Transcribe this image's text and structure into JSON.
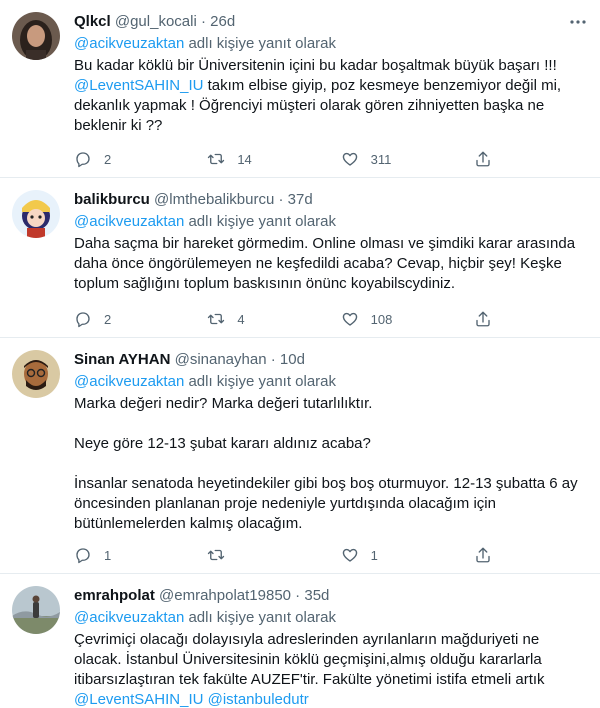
{
  "tweets": [
    {
      "name": "Qlkcl",
      "handle": "@gul_kocali",
      "time": "26d",
      "reply_prefix": "@acikveuzaktan",
      "reply_suffix": " adlı kişiye yanıt olarak",
      "lines": [
        "Bu kadar köklü bir Üniversitenin içini bu kadar boşaltmak büyük başarı !!!",
        {
          "link": "@LeventSAHIN_IU",
          "text": " takım elbise giyip, poz kesmeye benzemiyor değil mi,"
        },
        "dekanlık yapmak ! Öğrenciyi müşteri olarak gören zihniyetten başka ne",
        "beklenir ki ??"
      ],
      "reply_count": "2",
      "retweet_count": "14",
      "like_count": "311"
    },
    {
      "name": "balikburcu",
      "handle": "@lmthebalikburcu",
      "time": "37d",
      "reply_prefix": "@acikveuzaktan",
      "reply_suffix": " adlı kişiye yanıt olarak",
      "lines": [
        "Daha saçma bir hareket görmedim. Online olması ve şimdiki karar arasında",
        "daha önce öngörülemeyen ne keşfedildi acaba? Cevap, hiçbir şey! Keşke",
        "toplum sağlığını toplum baskısının önünc koyabilscydiniz."
      ],
      "reply_count": "2",
      "retweet_count": "4",
      "like_count": "108"
    },
    {
      "name": "Sinan AYHAN",
      "handle": "@sinanayhan",
      "time": "10d",
      "reply_prefix": "@acikveuzaktan",
      "reply_suffix": " adlı kişiye yanıt olarak",
      "lines": [
        "Marka değeri nedir? Marka değeri tutarlılıktır.",
        "",
        "Neye göre 12-13 şubat kararı aldınız acaba?",
        "",
        "İnsanlar senatoda heyetindekiler gibi boş boş oturmuyor. 12-13 şubatta 6 ay",
        "öncesinden planlanan proje nedeniyle yurtdışında olacağım için",
        "bütünlemelerden kalmış olacağım."
      ],
      "reply_count": "1",
      "retweet_count": "",
      "like_count": "1"
    },
    {
      "name": "emrahpolat",
      "handle": "@emrahpolat19850",
      "time": "35d",
      "reply_prefix": "@acikveuzaktan",
      "reply_suffix": " adlı kişiye yanıt olarak",
      "lines": [
        "Çevrimiçi olacağı dolayısıyla adreslerinden ayrılanların mağduriyeti ne",
        "olacak. İstanbul Üniversitesinin köklü geçmişini,almış olduğu kararlarla",
        "itibarsızlaştıran tek fakülte AUZEF'tir. Fakülte yönetimi istifa etmeli artık",
        {
          "link": "@LeventSAHIN_IU @istanbuledutr",
          "text": ""
        }
      ]
    }
  ],
  "separator": " · ",
  "colors": {
    "link": "#1d9bf0",
    "muted": "#536471",
    "text": "#0f1419",
    "border": "#e6ecf0"
  },
  "icons": [
    "reply-icon",
    "retweet-icon",
    "like-icon",
    "share-icon",
    "more-icon"
  ]
}
